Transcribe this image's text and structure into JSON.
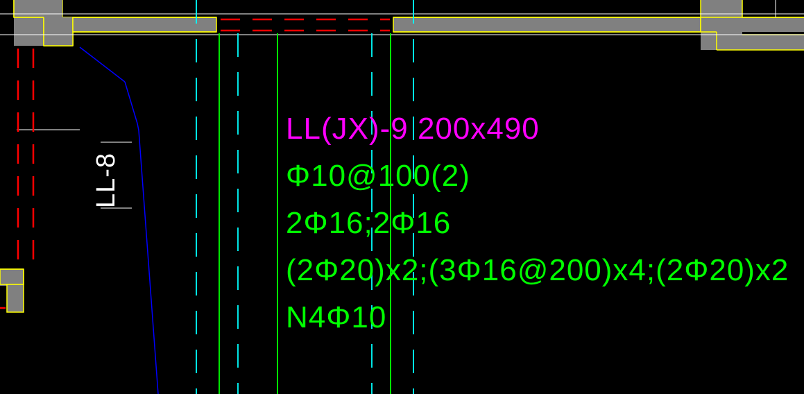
{
  "colors": {
    "bg": "#000000",
    "wall_fill": "#808080",
    "wall_edge": "#FFFF00",
    "red": "#FF0000",
    "green": "#00FF00",
    "magenta": "#FF00FF",
    "cyan": "#00FFFF",
    "blue": "#0000FF",
    "white": "#FFFFFF"
  },
  "side_label": {
    "text": "LL-8"
  },
  "beam_annotation": {
    "title": "LL(JX)-9 200x490",
    "stirrup": "Φ10@100(2)",
    "rebar_top_bottom": "2Φ16;2Φ16",
    "rebar_distribution": "(2Φ20)x2;(3Φ16@200)x4;(2Φ20)x2",
    "rebar_side": "N4Φ10"
  }
}
